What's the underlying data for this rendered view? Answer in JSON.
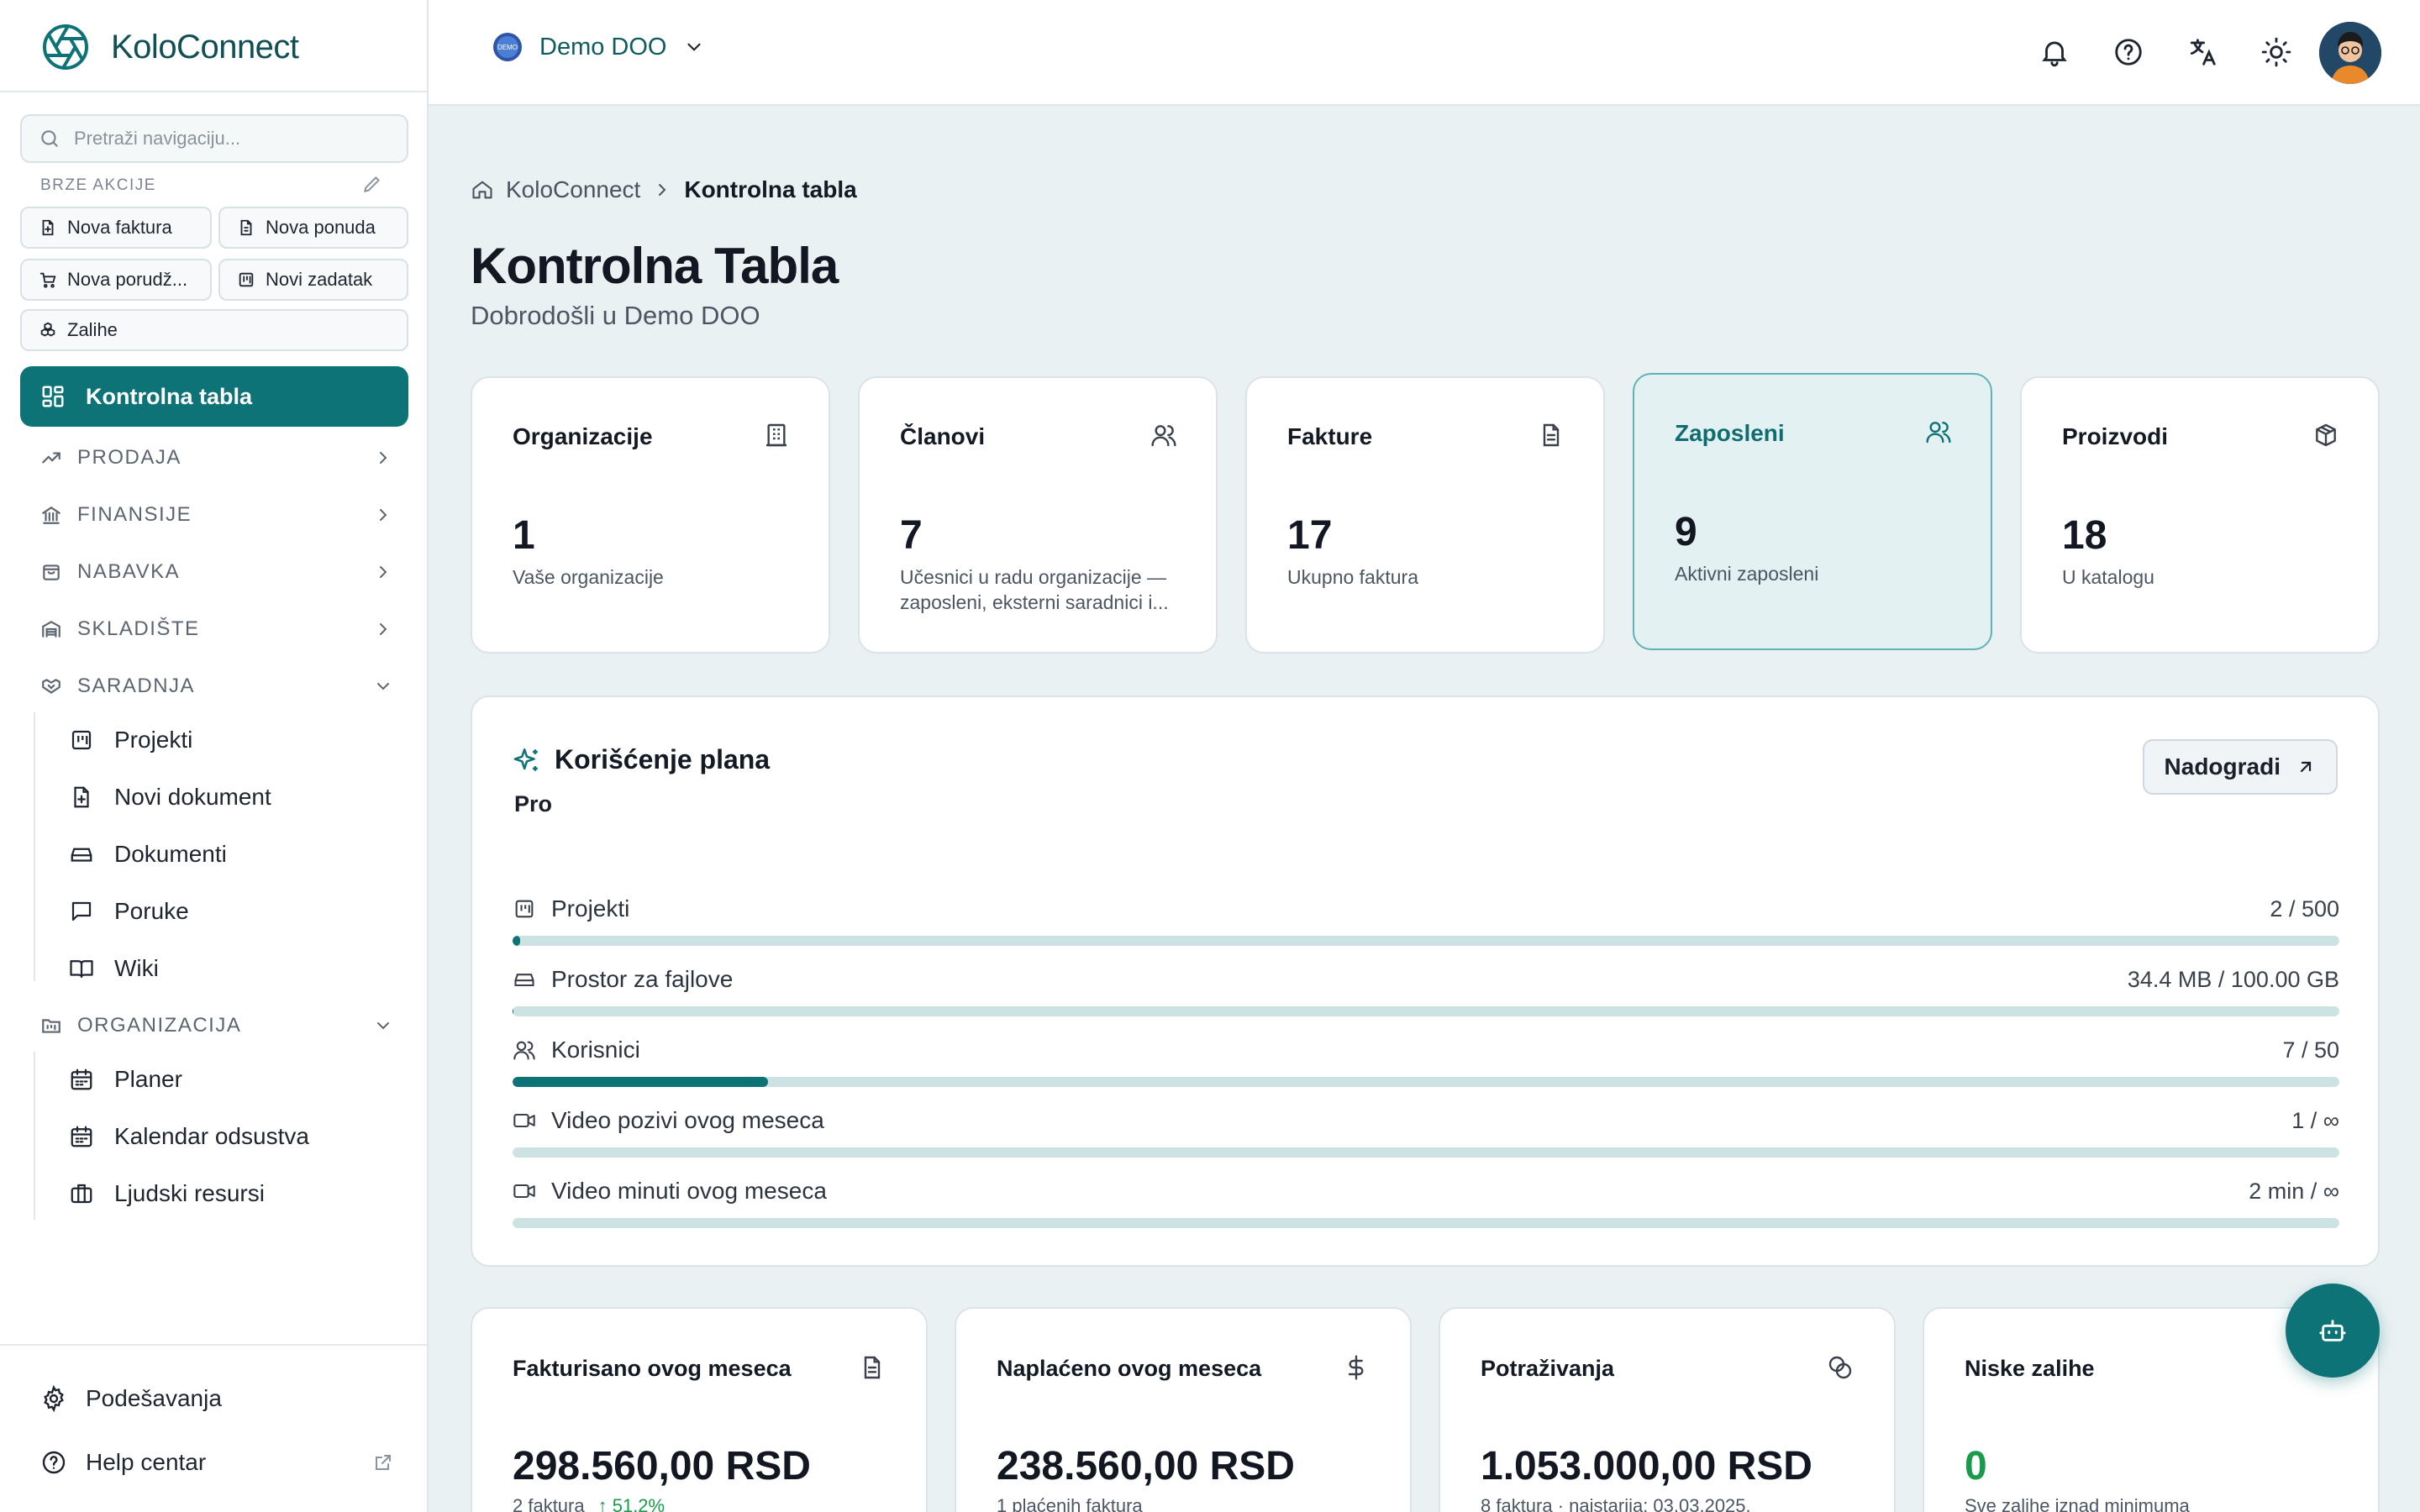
{
  "app": {
    "name": "KoloConnect"
  },
  "sidebar": {
    "search_placeholder": "Pretraži navigaciju...",
    "quick_actions_title": "BRZE AKCIJE",
    "quick_actions": [
      {
        "label": "Nova faktura",
        "icon": "file-plus-icon"
      },
      {
        "label": "Nova ponuda",
        "icon": "file-quote-icon"
      },
      {
        "label": "Nova porudž...",
        "icon": "cart-icon"
      },
      {
        "label": "Novi zadatak",
        "icon": "kanban-icon"
      },
      {
        "label": "Zalihe",
        "icon": "boxes-icon"
      }
    ],
    "active_item": {
      "label": "Kontrolna tabla",
      "icon": "dashboard-icon"
    },
    "sections": [
      {
        "label": "PRODAJA",
        "icon": "trending-icon",
        "expanded": false
      },
      {
        "label": "FINANSIJE",
        "icon": "bank-icon",
        "expanded": false
      },
      {
        "label": "NABAVKA",
        "icon": "shopping-bag-icon",
        "expanded": false
      },
      {
        "label": "SKLADIŠTE",
        "icon": "warehouse-icon",
        "expanded": false
      },
      {
        "label": "SARADNJA",
        "icon": "handshake-icon",
        "expanded": true
      },
      {
        "label": "ORGANIZACIJA",
        "icon": "folder-kanban-icon",
        "expanded": true
      }
    ],
    "saradnja_items": [
      {
        "label": "Projekti",
        "icon": "kanban-icon"
      },
      {
        "label": "Novi dokument",
        "icon": "file-plus-icon"
      },
      {
        "label": "Dokumenti",
        "icon": "drive-icon"
      },
      {
        "label": "Poruke",
        "icon": "message-icon"
      },
      {
        "label": "Wiki",
        "icon": "book-icon"
      }
    ],
    "organizacija_items": [
      {
        "label": "Planer",
        "icon": "calendar-icon"
      },
      {
        "label": "Kalendar odsustva",
        "icon": "calendar-icon"
      },
      {
        "label": "Ljudski resursi",
        "icon": "briefcase-icon"
      }
    ],
    "bottom": [
      {
        "label": "Podešavanja",
        "icon": "gear-icon"
      },
      {
        "label": "Help centar",
        "icon": "help-icon"
      }
    ]
  },
  "topbar": {
    "org_name": "Demo DOO",
    "org_badge": "DEMO"
  },
  "breadcrumb": {
    "root": "KoloConnect",
    "current": "Kontrolna tabla"
  },
  "page": {
    "title": "Kontrolna Tabla",
    "subtitle": "Dobrodošli u Demo DOO"
  },
  "stats": [
    {
      "label": "Organizacije",
      "value": "1",
      "desc": "Vaše organizacije",
      "icon": "building-icon"
    },
    {
      "label": "Članovi",
      "value": "7",
      "desc": "Učesnici u radu organizacije — zaposleni, eksterni saradnici i...",
      "icon": "users-icon"
    },
    {
      "label": "Fakture",
      "value": "17",
      "desc": "Ukupno faktura",
      "icon": "document-icon"
    },
    {
      "label": "Zaposleni",
      "value": "9",
      "desc": "Aktivni zaposleni",
      "icon": "users-icon"
    },
    {
      "label": "Proizvodi",
      "value": "18",
      "desc": "U katalogu",
      "icon": "package-icon"
    }
  ],
  "plan": {
    "title": "Korišćenje plana",
    "name": "Pro",
    "upgrade_label": "Nadogradi",
    "usage": [
      {
        "label": "Projekti",
        "value": "2 / 500",
        "fill": 0.004,
        "icon": "kanban-icon"
      },
      {
        "label": "Prostor za fajlove",
        "value": "34.4 MB / 100.00 GB",
        "fill": 0.0003,
        "icon": "drive-icon"
      },
      {
        "label": "Korisnici",
        "value": "7 / 50",
        "fill": 0.14,
        "icon": "users-icon"
      },
      {
        "label": "Video pozivi ovog meseca",
        "value": "1 / ∞",
        "fill": 0,
        "icon": "video-icon"
      },
      {
        "label": "Video minuti ovog meseca",
        "value": "2 min / ∞",
        "fill": 0,
        "icon": "video-icon"
      }
    ]
  },
  "finance": [
    {
      "label": "Fakturisano ovog meseca",
      "value": "298.560,00 RSD",
      "desc": "2 faktura",
      "trend": "↑ 51,2%",
      "icon": "document-icon"
    },
    {
      "label": "Naplaćeno ovog meseca",
      "value": "238.560,00 RSD",
      "desc": "1 plaćenih faktura",
      "trend": "",
      "icon": "dollar-icon"
    },
    {
      "label": "Potraživanja",
      "value": "1.053.000,00 RSD",
      "desc": "8 faktura · najstarija: 03.03.2025.",
      "trend": "",
      "icon": "coins-icon"
    },
    {
      "label": "Niske zalihe",
      "value": "0",
      "desc": "Sve zalihe iznad minimuma",
      "trend": "",
      "icon": "alert-icon"
    }
  ],
  "colors": {
    "accent": "#0d7377",
    "background": "#eaf1f3",
    "success": "#1a9a4b"
  }
}
